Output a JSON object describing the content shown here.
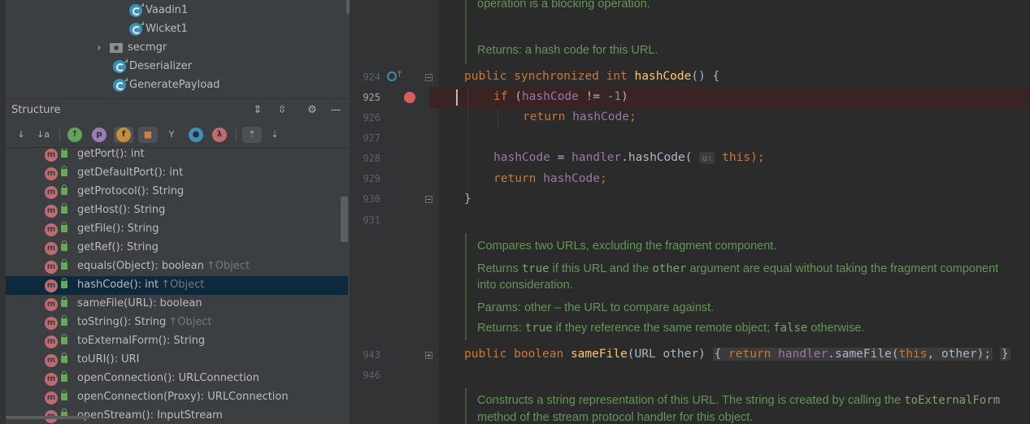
{
  "project_tree": {
    "items": [
      {
        "label": "Vaadin1",
        "icon": "java-class-icon"
      },
      {
        "label": "Wicket1",
        "icon": "java-class-icon"
      },
      {
        "label": "secmgr",
        "icon": "package-icon",
        "expander": "›"
      },
      {
        "label": "Deserializer",
        "icon": "java-class-icon"
      },
      {
        "label": "GeneratePayload",
        "icon": "java-class-icon"
      }
    ]
  },
  "structure": {
    "title": "Structure",
    "toolbar": {
      "sort_visibility": "↓",
      "sort_alpha": "↓a",
      "inherited": "↑",
      "properties": "p",
      "fields": "f",
      "non_public": "🔒",
      "anonymous": "Y",
      "lambdas": "λ",
      "autoscroll_to": "⇡",
      "autoscroll_from": "⇣"
    },
    "members": [
      {
        "text": "getPort(): int",
        "parent": ""
      },
      {
        "text": "getDefaultPort(): int",
        "parent": ""
      },
      {
        "text": "getProtocol(): String",
        "parent": ""
      },
      {
        "text": "getHost(): String",
        "parent": ""
      },
      {
        "text": "getFile(): String",
        "parent": ""
      },
      {
        "text": "getRef(): String",
        "parent": ""
      },
      {
        "text": "equals(Object): boolean",
        "parent": "↑Object"
      },
      {
        "text": "hashCode(): int",
        "parent": "↑Object",
        "selected": true
      },
      {
        "text": "sameFile(URL): boolean",
        "parent": ""
      },
      {
        "text": "toString(): String",
        "parent": "↑Object"
      },
      {
        "text": "toExternalForm(): String",
        "parent": ""
      },
      {
        "text": "toURI(): URI",
        "parent": ""
      },
      {
        "text": "openConnection(): URLConnection",
        "parent": ""
      },
      {
        "text": "openConnection(Proxy): URLConnection",
        "parent": ""
      },
      {
        "text": "openStream(): InputStream",
        "parent": ""
      }
    ],
    "method_icon_letter": "m"
  },
  "editor": {
    "line_numbers": [
      "924",
      "925",
      "926",
      "927",
      "928",
      "929",
      "930",
      "931",
      "943",
      "946"
    ],
    "doc1": {
      "line1": "operation is a blocking operation.",
      "line2": "Returns: a hash code for this URL."
    },
    "code": {
      "l924_kw": "public synchronized int ",
      "l924_fn": "hashCode",
      "l924_rest": "() {",
      "l925_kw": "if ",
      "l925_open": "(",
      "l925_field": "hashCode",
      "l925_op": " != ",
      "l925_num": "-1",
      "l925_close": ")",
      "l926_kw": "return ",
      "l926_field": "hashCode",
      "l926_semi": ";",
      "l928_field": "hashCode",
      "l928_eq": " = ",
      "l928_handler": "handler",
      "l928_call": ".hashCode( ",
      "l928_hint": "u:",
      "l928_this": " this",
      "l928_end": ");",
      "l929_kw": "return ",
      "l929_field": "hashCode",
      "l929_semi": ";",
      "l930": "}",
      "l943_kw": "public boolean ",
      "l943_fn": "sameFile",
      "l943_params": "(URL other)",
      "l943_open": "{",
      "l943_ret": " return ",
      "l943_handler": "handler",
      "l943_call": ".sameFile(",
      "l943_this": "this",
      "l943_args": ", other);",
      "l943_close": "}"
    },
    "doc2": {
      "line1": "Compares two URLs, excluding the fragment component.",
      "line2a": "Returns ",
      "line2b": "true",
      "line2c": " if this URL and the ",
      "line2d": "other",
      "line2e": " argument are equal without taking the fragment component",
      "line3": "into consideration.",
      "line4": "Params:  other – the URL to compare against.",
      "line5a": "Returns: ",
      "line5b": "true",
      "line5c": " if they reference the same remote object; ",
      "line5d": "false",
      "line5e": " otherwise."
    },
    "doc3": {
      "line1a": "Constructs a string representation of this URL. The string is created by calling the ",
      "line1b": "toExternalForm",
      "line2": "method of the stream protocol handler for this object."
    }
  }
}
